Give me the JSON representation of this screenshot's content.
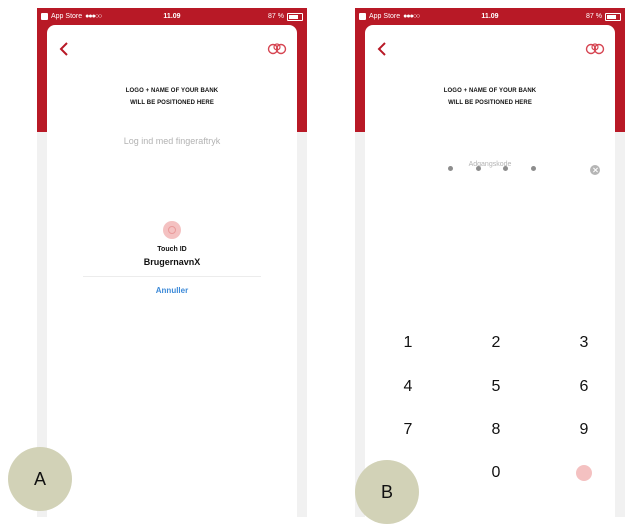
{
  "status_bar": {
    "carrier": "App Store",
    "signal": "●●●○○",
    "time": "11.09",
    "battery": "87 %"
  },
  "screen_a": {
    "logo_text_line1": "LOGO + NAME OF YOUR BANK",
    "logo_text_line2": "WILL BE POSITIONED HERE",
    "prompt": "Log ind med fingeraftryk",
    "touch_title": "Touch ID",
    "touch_user": "BrugernavnX",
    "cancel_label": "Annuller",
    "badge": "A"
  },
  "screen_b": {
    "logo_text_line1": "LOGO + NAME OF YOUR BANK",
    "logo_text_line2": "WILL BE POSITIONED HERE",
    "code_label": "Adgangskode",
    "pin_length": 4,
    "keys": [
      "1",
      "2",
      "3",
      "4",
      "5",
      "6",
      "7",
      "8",
      "9",
      "",
      "0",
      ""
    ],
    "badge": "B"
  },
  "colors": {
    "brand_red": "#b81926",
    "link_blue": "#3d8ad8",
    "badge": "#d2d2b7"
  },
  "icons": [
    "back-chevron-icon",
    "bank-logo-icon",
    "fingerprint-icon",
    "clear-icon",
    "battery-icon"
  ]
}
